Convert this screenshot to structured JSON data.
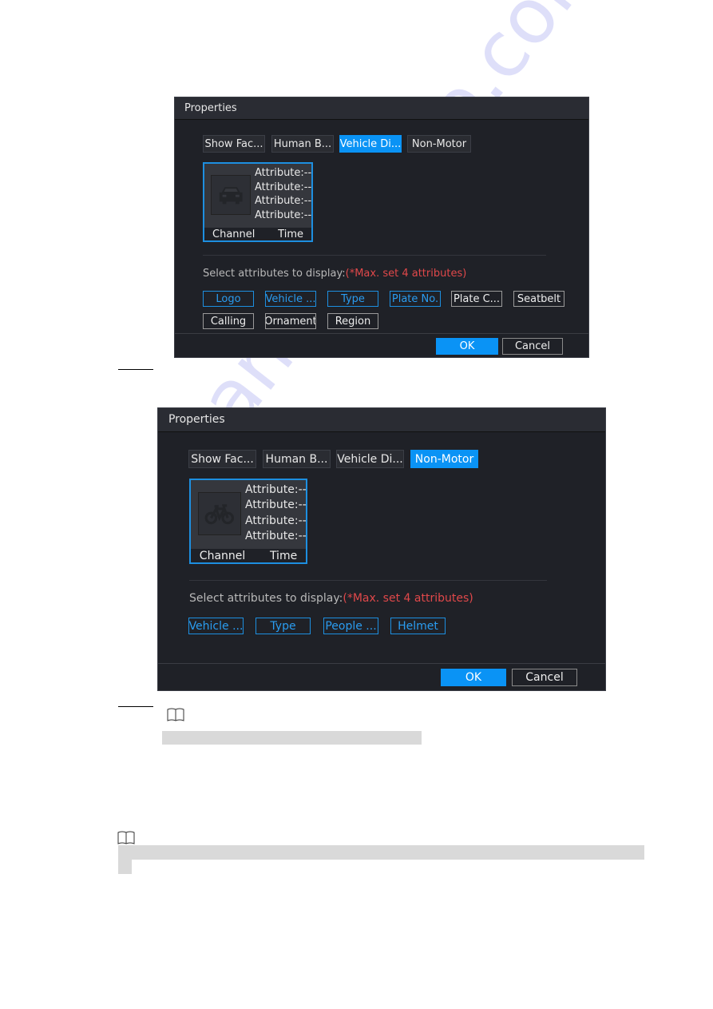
{
  "dialogs": [
    {
      "title": "Properties",
      "tabs": [
        {
          "label": "Show Fac...",
          "active": false
        },
        {
          "label": "Human B...",
          "active": false
        },
        {
          "label": "Vehicle Di...",
          "active": true
        },
        {
          "label": "Non-Motor",
          "active": false
        }
      ],
      "preview": {
        "icon": "car-icon",
        "attributes": [
          "Attribute:--",
          "Attribute:--",
          "Attribute:--",
          "Attribute:--"
        ],
        "channel": "Channel",
        "time": "Time"
      },
      "hint": "Select attributes to display:",
      "hint_warning": "(*Max. set 4 attributes)",
      "attribute_buttons": [
        {
          "label": "Logo",
          "selected": true
        },
        {
          "label": "Vehicle ...",
          "selected": true
        },
        {
          "label": "Type",
          "selected": true
        },
        {
          "label": "Plate No.",
          "selected": true
        },
        {
          "label": "Plate C...",
          "selected": false
        },
        {
          "label": "Seatbelt",
          "selected": false
        },
        {
          "label": "Calling",
          "selected": false
        },
        {
          "label": "Ornament",
          "selected": false
        },
        {
          "label": "Region",
          "selected": false
        }
      ],
      "ok_label": "OK",
      "cancel_label": "Cancel"
    },
    {
      "title": "Properties",
      "tabs": [
        {
          "label": "Show Fac...",
          "active": false
        },
        {
          "label": "Human B...",
          "active": false
        },
        {
          "label": "Vehicle Di...",
          "active": false
        },
        {
          "label": "Non-Motor",
          "active": true
        }
      ],
      "preview": {
        "icon": "bicycle-icon",
        "attributes": [
          "Attribute:--",
          "Attribute:--",
          "Attribute:--",
          "Attribute:--"
        ],
        "channel": "Channel",
        "time": "Time"
      },
      "hint": "Select attributes to display:",
      "hint_warning": "(*Max. set 4 attributes)",
      "attribute_buttons": [
        {
          "label": "Vehicle ...",
          "selected": true
        },
        {
          "label": "Type",
          "selected": true
        },
        {
          "label": "People ...",
          "selected": true
        },
        {
          "label": "Helmet",
          "selected": true
        }
      ],
      "ok_label": "OK",
      "cancel_label": "Cancel"
    }
  ],
  "notes": [
    {
      "icon": "book-icon"
    },
    {
      "icon": "book-icon"
    }
  ],
  "watermark": "manualshive.com",
  "colors": {
    "accent": "#0a93f5",
    "warning": "#e0484a",
    "dialog_bg": "#1f2127"
  }
}
